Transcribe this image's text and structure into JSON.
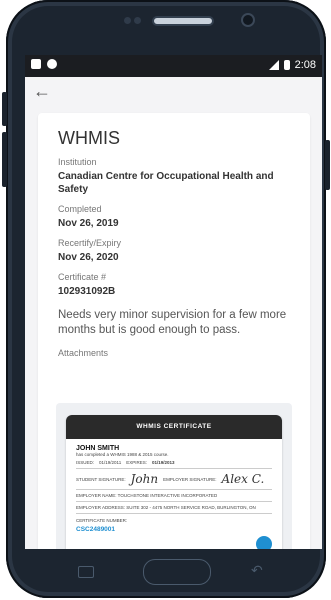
{
  "status_bar": {
    "time": "2:08"
  },
  "nav": {
    "back_icon": "arrow-left-icon"
  },
  "record": {
    "title": "WHMIS",
    "institution_label": "Institution",
    "institution": "Canadian Centre for Occupational Health and Safety",
    "completed_label": "Completed",
    "completed": "Nov 26, 2019",
    "expiry_label": "Recertify/Expiry",
    "expiry": "Nov 26, 2020",
    "certificate_label": "Certificate #",
    "certificate_number": "102931092B",
    "notes": "Needs very minor supervision for a few more months but is good enough to pass.",
    "attachments_label": "Attachments"
  },
  "certificate_image": {
    "header": "WHMIS CERTIFICATE",
    "name": "JOHN SMITH",
    "completed_line": "has completed a WHMIS 1988 & 2015 course.",
    "issued_label": "ISSUED:",
    "issued": "01/19/2011",
    "expires_label": "EXPIRES:",
    "expires": "01/19/2013",
    "student_signature_label": "STUDENT SIGNATURE:",
    "student_signature": "John",
    "employer_signature_label": "EMPLOYER SIGNATURE:",
    "employer_signature": "Alex C.",
    "employer_name": "EMPLOYER NAME: TOUCHSTONE INTERACTIVE INCORPORATED",
    "employer_address": "EMPLOYER ADDRESS: SUITE 302 - 4475 NORTH SERVICE ROAD, BURLINGTON, ON",
    "certificate_number_label": "CERTIFICATE NUMBER:",
    "certificate_number": "CSC2489001"
  }
}
